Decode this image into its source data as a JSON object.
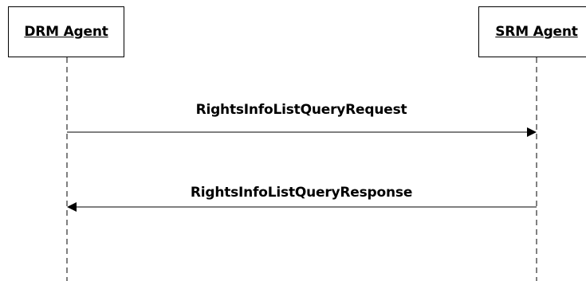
{
  "actors": [
    {
      "label": "DRM Agent"
    },
    {
      "label": "SRM Agent"
    }
  ],
  "messages": [
    {
      "label": "RightsInfoListQueryRequest",
      "from": "DRM Agent",
      "to": "SRM Agent"
    },
    {
      "label": "RightsInfoListQueryResponse",
      "from": "SRM Agent",
      "to": "DRM Agent"
    }
  ]
}
